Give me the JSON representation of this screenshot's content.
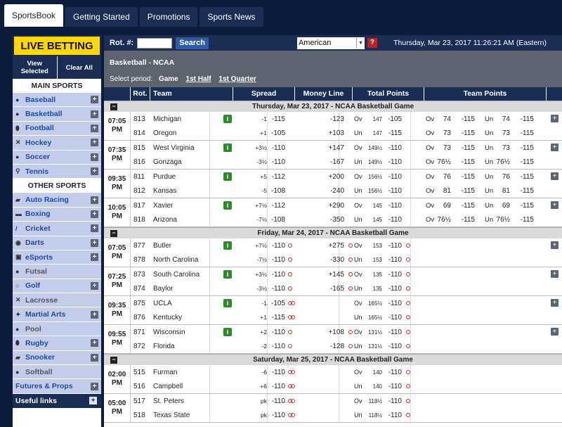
{
  "topnav": {
    "tabs": [
      "SportsBook",
      "Getting Started",
      "Promotions",
      "Sports News"
    ]
  },
  "sidebar": {
    "live": "LIVE BETTING",
    "view": "View Selected",
    "clear": "Clear All",
    "main_title": "MAIN SPORTS",
    "main": [
      {
        "label": "Baseball",
        "icon": "baseball-icon",
        "glyph": "●"
      },
      {
        "label": "Basketball",
        "icon": "basketball-icon",
        "glyph": "●"
      },
      {
        "label": "Football",
        "icon": "football-icon",
        "glyph": "⬮"
      },
      {
        "label": "Hockey",
        "icon": "hockey-icon",
        "glyph": "✕"
      },
      {
        "label": "Soccer",
        "icon": "soccer-icon",
        "glyph": "●"
      },
      {
        "label": "Tennis",
        "icon": "tennis-icon",
        "glyph": "⚲"
      }
    ],
    "other_title": "OTHER SPORTS",
    "other": [
      {
        "label": "Auto Racing",
        "icon": "racing-car-icon",
        "glyph": "▰",
        "plus": true
      },
      {
        "label": "Boxing",
        "icon": "boxing-glove-icon",
        "glyph": "▬",
        "plus": true
      },
      {
        "label": "Cricket",
        "icon": "cricket-bat-icon",
        "glyph": "/",
        "plus": true
      },
      {
        "label": "Darts",
        "icon": "darts-icon",
        "glyph": "◉",
        "plus": true
      },
      {
        "label": "eSports",
        "icon": "gamepad-icon",
        "glyph": "▣",
        "plus": true
      },
      {
        "label": "Futsal",
        "icon": "futsal-icon",
        "glyph": "●",
        "plus": false
      },
      {
        "label": "Golf",
        "icon": "golf-icon",
        "glyph": "○",
        "plus": true
      },
      {
        "label": "Lacrosse",
        "icon": "lacrosse-icon",
        "glyph": "✕",
        "plus": false
      },
      {
        "label": "Martial Arts",
        "icon": "martial-arts-icon",
        "glyph": "✦",
        "plus": true
      },
      {
        "label": "Pool",
        "icon": "pool-ball-icon",
        "glyph": "●",
        "plus": false
      },
      {
        "label": "Rugby",
        "icon": "rugby-ball-icon",
        "glyph": "⬮",
        "plus": true
      },
      {
        "label": "Snooker",
        "icon": "snooker-icon",
        "glyph": "▰",
        "plus": true
      },
      {
        "label": "Softball",
        "icon": "softball-icon",
        "glyph": "●",
        "plus": false
      },
      {
        "label": "Futures & Props",
        "icon": "",
        "glyph": "",
        "plus": true
      }
    ],
    "useful": "Useful links"
  },
  "toolbar": {
    "rot_label": "Rot. #:",
    "search": "Search",
    "odds_format": "American",
    "help": "?",
    "datetime": "Thursday, Mar 23, 2017 11:26:21 AM (Eastern)"
  },
  "league": {
    "name": "Basketball - NCAA",
    "period_label": "Select period:",
    "periods": [
      "Game",
      "1st Half",
      "1st Quarter"
    ]
  },
  "columns": [
    "Rot.",
    "Team",
    "Spread",
    "Money Line",
    "Total Points",
    "Team Points"
  ],
  "sections": [
    {
      "date": "Thursday, Mar 23, 2017 - NCAA Basketball Game",
      "games": [
        {
          "time": [
            "07:05",
            "PM"
          ],
          "info": true,
          "dots": false,
          "plus": true,
          "rows": [
            {
              "rot": "813",
              "team": "Michigan",
              "sp": "-1",
              "spo": "-115",
              "ml": "-123",
              "ou": "Ov",
              "oun": "147",
              "ouo": "-105",
              "t1": "Ov",
              "t1n": "74",
              "t1o": "-115",
              "t2": "Un",
              "t2n": "74",
              "t2o": "-115"
            },
            {
              "rot": "814",
              "team": "Oregon",
              "sp": "+1",
              "spo": "-105",
              "ml": "+103",
              "ou": "Un",
              "oun": "147",
              "ouo": "-115",
              "t1": "Ov",
              "t1n": "73",
              "t1o": "-115",
              "t2": "Un",
              "t2n": "73",
              "t2o": "-115"
            }
          ]
        },
        {
          "time": [
            "07:35",
            "PM"
          ],
          "info": true,
          "dots": false,
          "plus": true,
          "rows": [
            {
              "rot": "815",
              "team": "West Virginia",
              "sp": "+3½",
              "spo": "-110",
              "ml": "+147",
              "ou": "Ov",
              "oun": "149½",
              "ouo": "-110",
              "t1": "Ov",
              "t1n": "73",
              "t1o": "-115",
              "t2": "Un",
              "t2n": "73",
              "t2o": "-115"
            },
            {
              "rot": "816",
              "team": "Gonzaga",
              "sp": "-3½",
              "spo": "-110",
              "ml": "-167",
              "ou": "Un",
              "oun": "149½",
              "ouo": "-110",
              "t1": "Ov",
              "t1n": "76½",
              "t1o": "-115",
              "t2": "Un",
              "t2n": "76½",
              "t2o": "-115"
            }
          ]
        },
        {
          "time": [
            "09:35",
            "PM"
          ],
          "info": true,
          "dots": false,
          "plus": true,
          "rows": [
            {
              "rot": "811",
              "team": "Purdue",
              "sp": "+5",
              "spo": "-112",
              "ml": "+200",
              "ou": "Ov",
              "oun": "156½",
              "ouo": "-110",
              "t1": "Ov",
              "t1n": "76",
              "t1o": "-115",
              "t2": "Un",
              "t2n": "76",
              "t2o": "-115"
            },
            {
              "rot": "812",
              "team": "Kansas",
              "sp": "-5",
              "spo": "-108",
              "ml": "-240",
              "ou": "Un",
              "oun": "156½",
              "ouo": "-110",
              "t1": "Ov",
              "t1n": "81",
              "t1o": "-115",
              "t2": "Un",
              "t2n": "81",
              "t2o": "-115"
            }
          ]
        },
        {
          "time": [
            "10:05",
            "PM"
          ],
          "info": true,
          "dots": false,
          "plus": true,
          "rows": [
            {
              "rot": "817",
              "team": "Xavier",
              "sp": "+7½",
              "spo": "-112",
              "ml": "+290",
              "ou": "Ov",
              "oun": "145",
              "ouo": "-110",
              "t1": "Ov",
              "t1n": "69",
              "t1o": "-115",
              "t2": "Un",
              "t2n": "69",
              "t2o": "-115"
            },
            {
              "rot": "818",
              "team": "Arizona",
              "sp": "-7½",
              "spo": "-108",
              "ml": "-350",
              "ou": "Un",
              "oun": "145",
              "ouo": "-110",
              "t1": "Ov",
              "t1n": "76½",
              "t1o": "-115",
              "t2": "Un",
              "t2n": "76½",
              "t2o": "-115"
            }
          ]
        }
      ]
    },
    {
      "date": "Friday, Mar 24, 2017 - NCAA Basketball Game",
      "games": [
        {
          "time": [
            "07:05",
            "PM"
          ],
          "info": true,
          "dots": true,
          "plus": true,
          "rows": [
            {
              "rot": "877",
              "team": "Butler",
              "sp": "+7½",
              "spo": "-110",
              "ml": "+275",
              "ou": "Ov",
              "oun": "153",
              "ouo": "-110"
            },
            {
              "rot": "878",
              "team": "North Carolina",
              "sp": "-7½",
              "spo": "-110",
              "ml": "-330",
              "ou": "Un",
              "oun": "153",
              "ouo": "-110"
            }
          ]
        },
        {
          "time": [
            "07:25",
            "PM"
          ],
          "info": true,
          "dots": true,
          "plus": true,
          "rows": [
            {
              "rot": "873",
              "team": "South Carolina",
              "sp": "+3½",
              "spo": "-110",
              "ml": "+145",
              "ou": "Ov",
              "oun": "135",
              "ouo": "-110"
            },
            {
              "rot": "874",
              "team": "Baylor",
              "sp": "-3½",
              "spo": "-110",
              "ml": "-165",
              "ou": "Un",
              "oun": "135",
              "ouo": "-110"
            }
          ]
        },
        {
          "time": [
            "09:35",
            "PM"
          ],
          "info": true,
          "dots": true,
          "plus": true,
          "rows": [
            {
              "rot": "875",
              "team": "UCLA",
              "sp": "-1",
              "spo": "-105",
              "ml": "",
              "ou": "Ov",
              "oun": "165½",
              "ouo": "-110"
            },
            {
              "rot": "876",
              "team": "Kentucky",
              "sp": "+1",
              "spo": "-115",
              "ml": "",
              "ou": "Un",
              "oun": "165½",
              "ouo": "-110"
            }
          ]
        },
        {
          "time": [
            "09:55",
            "PM"
          ],
          "info": true,
          "dots": true,
          "plus": true,
          "rows": [
            {
              "rot": "871",
              "team": "Wisconsin",
              "sp": "+2",
              "spo": "-110",
              "ml": "+108",
              "ou": "Ov",
              "oun": "131½",
              "ouo": "-110"
            },
            {
              "rot": "872",
              "team": "Florida",
              "sp": "-2",
              "spo": "-110",
              "ml": "-128",
              "ou": "Un",
              "oun": "131½",
              "ouo": "-110"
            }
          ]
        }
      ]
    },
    {
      "date": "Saturday, Mar 25, 2017 - NCAA Basketball Game",
      "games": [
        {
          "time": [
            "02:00",
            "PM"
          ],
          "info": false,
          "dots": true,
          "plus": false,
          "rows": [
            {
              "rot": "515",
              "team": "Furman",
              "sp": "-6",
              "spo": "-110",
              "ml": "",
              "ou": "Ov",
              "oun": "140",
              "ouo": "-110"
            },
            {
              "rot": "516",
              "team": "Campbell",
              "sp": "+6",
              "spo": "-110",
              "ml": "",
              "ou": "Un",
              "oun": "140",
              "ouo": "-110"
            }
          ]
        },
        {
          "time": [
            "05:00",
            "PM"
          ],
          "info": false,
          "dots": true,
          "plus": false,
          "rows": [
            {
              "rot": "517",
              "team": "St. Peters",
              "sp": "pk",
              "spo": "-110",
              "ml": "",
              "ou": "Ov",
              "oun": "118½",
              "ouo": "-110"
            },
            {
              "rot": "518",
              "team": "Texas State",
              "sp": "pk",
              "spo": "-110",
              "ml": "",
              "ou": "Un",
              "oun": "118½",
              "ouo": "-110"
            }
          ]
        }
      ]
    }
  ]
}
